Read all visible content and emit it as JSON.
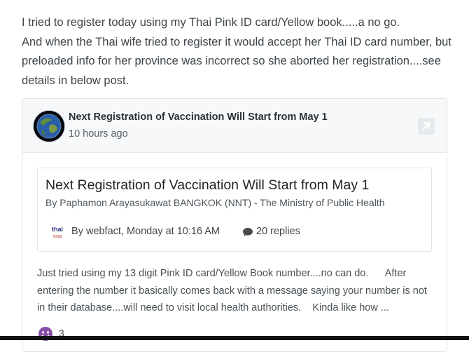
{
  "post": {
    "text": "I tried to register today using my Thai Pink ID card/Yellow book.....a no go.\n And when the Thai wife tried to register it would accept her Thai ID card number, but preloaded info for her province was incorrect so she aborted her registration....see details in below post."
  },
  "embed": {
    "title": "Next Registration of Vaccination Will Start from May 1",
    "time": "10 hours ago",
    "inner": {
      "title": "Next Registration of Vaccination Will Start from May 1",
      "meta": "By Paphamon Arayasukawat      BANGKOK (NNT) - The Ministry of Public Health",
      "logo_text_top": "thai",
      "logo_text_bottom": "visa",
      "byline": "By webfact, Monday at 10:16 AM",
      "replies": "20 replies"
    },
    "excerpt": "Just tried using my 13 digit Pink ID card/Yellow Book number....no can do.      After entering the number it basically comes back with a message saying your number is not in their database....will need to visit local health authorities.    Kinda like how ...",
    "reaction_count": "3"
  },
  "colors": {
    "header_bg": "#f6f8f9",
    "border": "#dfe3e6",
    "reaction_purple": "#8a4fa8"
  }
}
